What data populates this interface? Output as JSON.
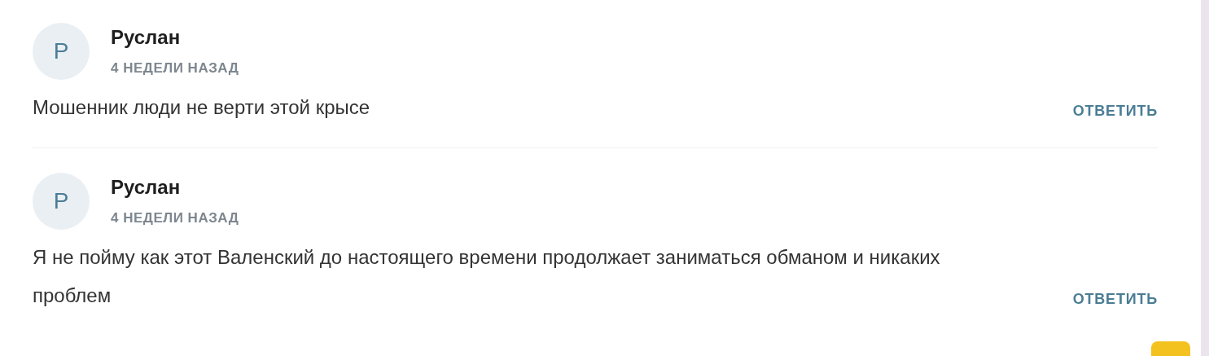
{
  "comments": [
    {
      "avatar": "Р",
      "author": "Руслан",
      "date": "4 НЕДЕЛИ НАЗАД",
      "text": "Мошенник люди не верти этой крысе",
      "reply": "ОТВЕТИТЬ"
    },
    {
      "avatar": "Р",
      "author": "Руслан",
      "date": "4 НЕДЕЛИ НАЗАД",
      "text": "Я не пойму как этот Валенский до настоящего времени продолжает заниматься обманом и никаких проблем",
      "reply": "ОТВЕТИТЬ"
    }
  ]
}
